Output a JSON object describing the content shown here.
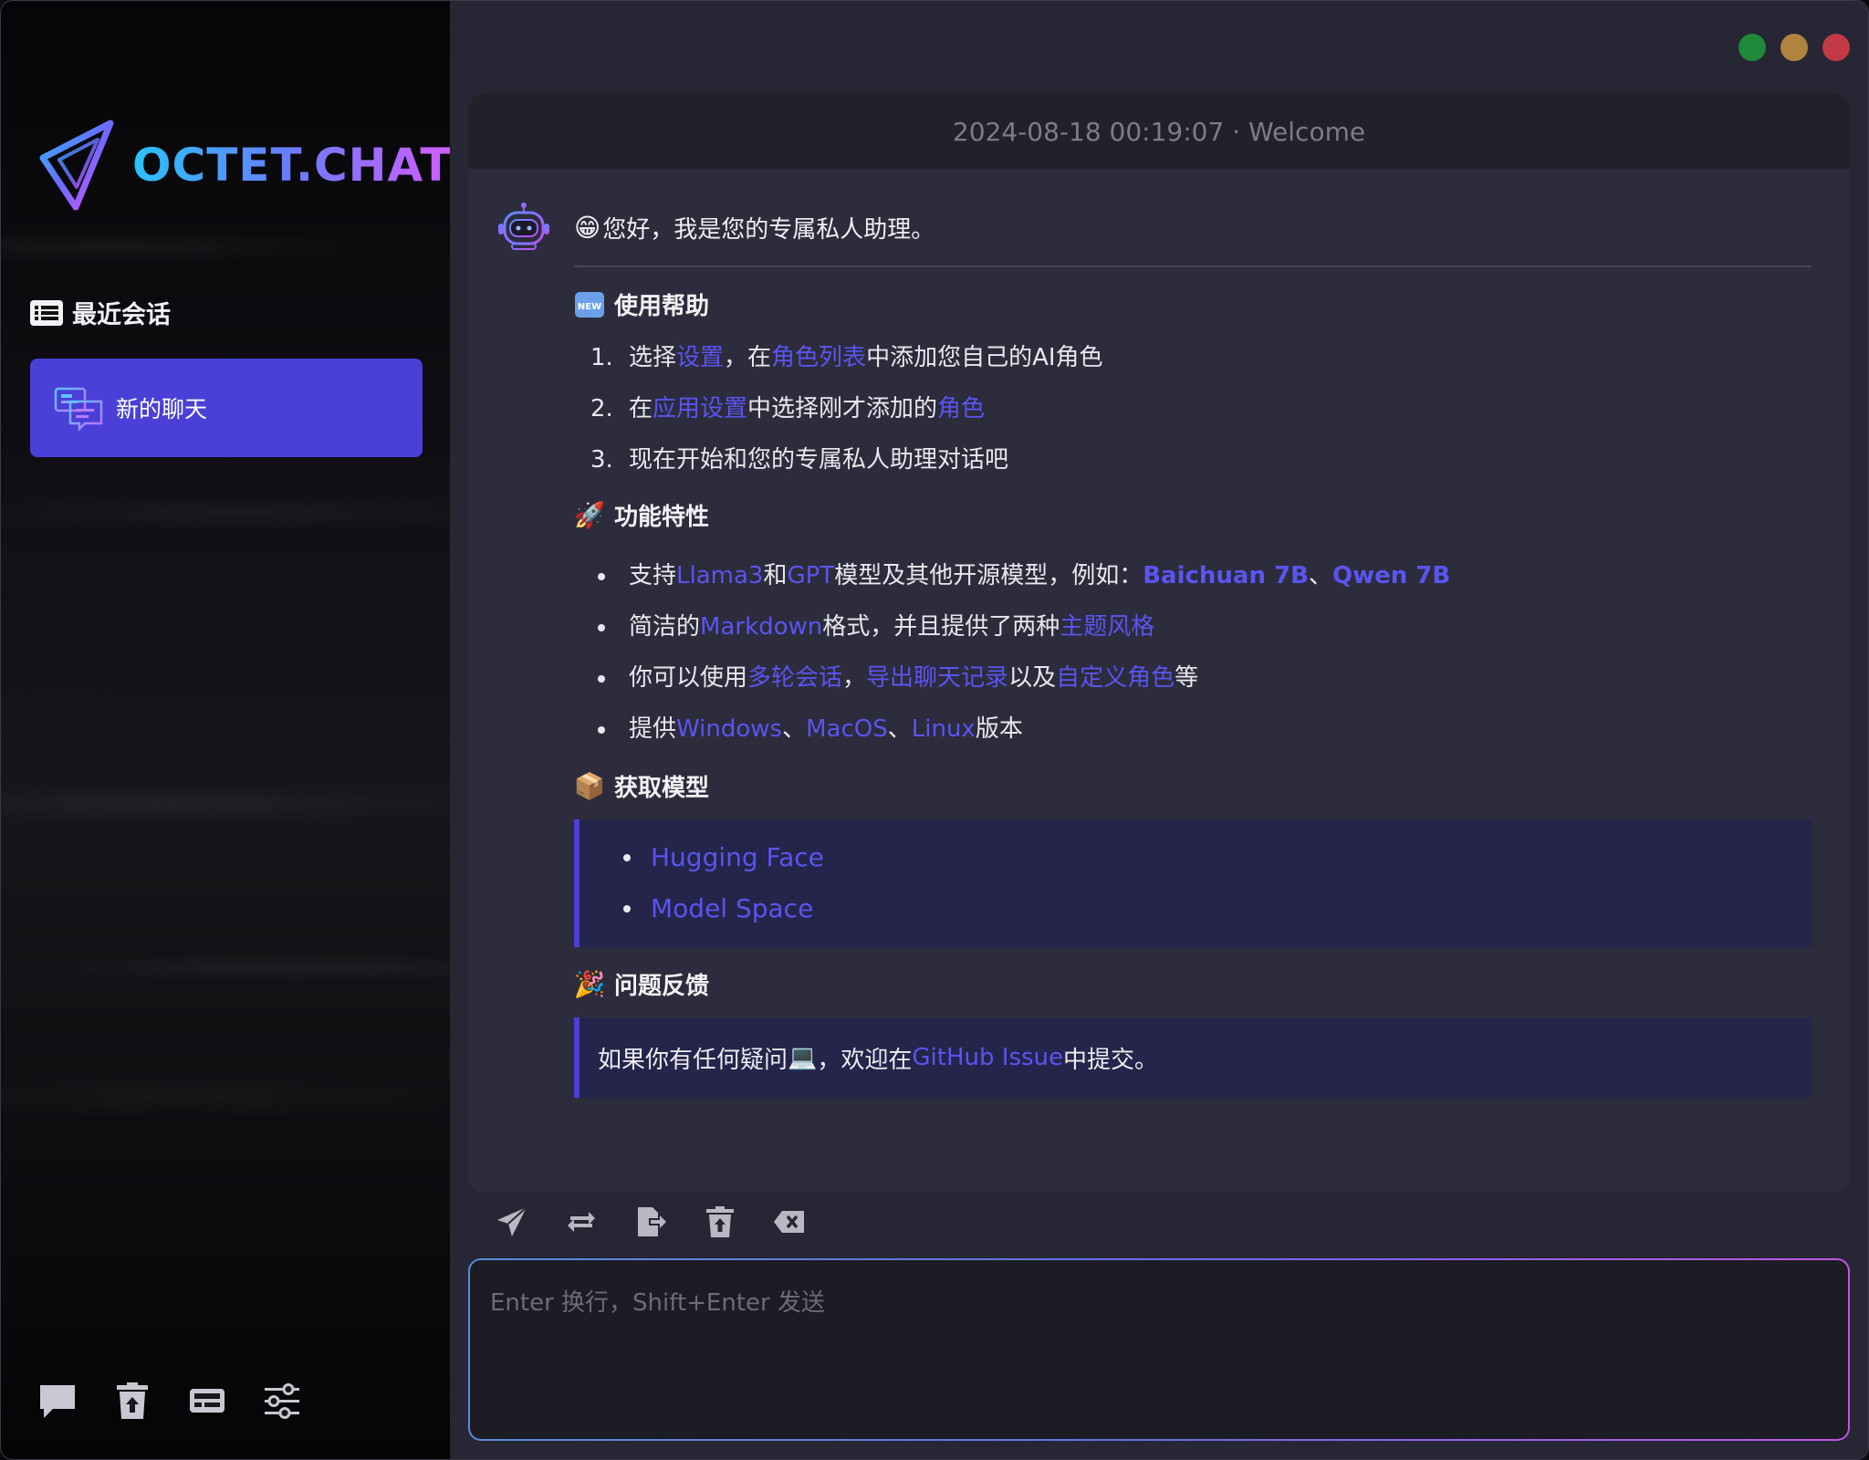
{
  "window": {
    "controls": [
      "green",
      "yellow",
      "red"
    ],
    "colors": {
      "green": "#1e8a3a",
      "yellow": "#b0843e",
      "red": "#c23a45"
    }
  },
  "sidebar": {
    "logo_text": "OCTET.CHAT",
    "recent_title": "最近会话",
    "chats": [
      {
        "label": "新的聊天",
        "active": true
      }
    ],
    "tools": [
      "comment-icon",
      "trash-icon",
      "keyboard-icon",
      "sliders-icon"
    ]
  },
  "chat": {
    "header": "2024-08-18 00:19:07 · Welcome",
    "greeting_emoji": "😁",
    "greeting": "您好，我是您的专属私人助理。",
    "help": {
      "emoji": "🆕",
      "title": "使用帮助",
      "steps": [
        {
          "num": "1.",
          "t1": "选择",
          "l1": "设置",
          "t2": "，在",
          "l2": "角色列表",
          "t3": "中添加您自己的AI角色"
        },
        {
          "num": "2.",
          "t1": "在",
          "l1": "应用设置",
          "t2": "中选择刚才添加的",
          "l2": "角色",
          "t3": ""
        },
        {
          "num": "3.",
          "t1": "现在开始和您的专属私人助理对话吧"
        }
      ]
    },
    "features": {
      "emoji": "🚀",
      "title": "功能特性",
      "items": [
        {
          "t1": "支持",
          "l1": "Llama3",
          "t2": "和",
          "l2": "GPT",
          "t3": "模型及其他开源模型，例如：",
          "l3": "Baichuan 7B",
          "t4": "、",
          "l4": "Qwen 7B"
        },
        {
          "t1": "简洁的",
          "l1": "Markdown",
          "t2": "格式，并且提供了两种",
          "l2": "主题风格"
        },
        {
          "t1": "你可以使用",
          "l1": "多轮会话",
          "t2": "，",
          "l2": "导出聊天记录",
          "t3": "以及",
          "l3": "自定义角色",
          "t4": "等"
        },
        {
          "t1": "提供",
          "l1": "Windows",
          "t2": "、",
          "l2": "MacOS",
          "t3": "、",
          "l3": "Linux",
          "t4": "版本"
        }
      ]
    },
    "models": {
      "emoji": "📦",
      "title": "获取模型",
      "links": [
        "Hugging Face",
        "Model Space"
      ]
    },
    "feedback": {
      "emoji": "🎉",
      "title": "问题反馈",
      "t1": "如果你有任何疑问",
      "icon": "💻",
      "t2": "，欢迎在",
      "link": "GitHub Issue",
      "t3": "中提交。"
    }
  },
  "toolbar": [
    "send-icon",
    "retry-icon",
    "export-icon",
    "clear-icon",
    "backspace-icon"
  ],
  "input": {
    "placeholder": "Enter 换行，Shift+Enter 发送",
    "value": ""
  },
  "colors": {
    "accent": "#4a40d8",
    "link": "#5a54f0"
  }
}
